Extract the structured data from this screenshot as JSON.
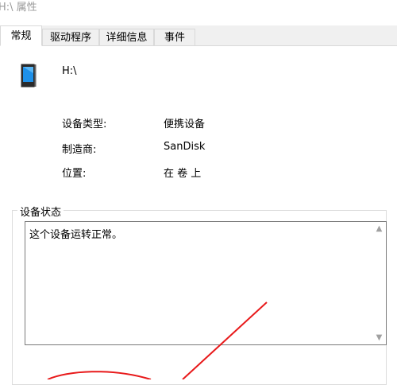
{
  "window": {
    "title": "H:\\ 属性"
  },
  "tabs": [
    {
      "label": "常规",
      "active": true
    },
    {
      "label": "驱动程序",
      "active": false
    },
    {
      "label": "详细信息",
      "active": false
    },
    {
      "label": "事件",
      "active": false
    }
  ],
  "device": {
    "icon": "portable-device-icon",
    "name": "H:\\",
    "type_label": "设备类型:",
    "type_value": "便携设备",
    "manufacturer_label": "制造商:",
    "manufacturer_value": "SanDisk",
    "location_label": "位置:",
    "location_value": "在 卷 上"
  },
  "status": {
    "group_title": "设备状态",
    "text": "这个设备运转正常。"
  },
  "colors": {
    "annotation": "#e8191a",
    "accent_device": "#0078d7"
  }
}
